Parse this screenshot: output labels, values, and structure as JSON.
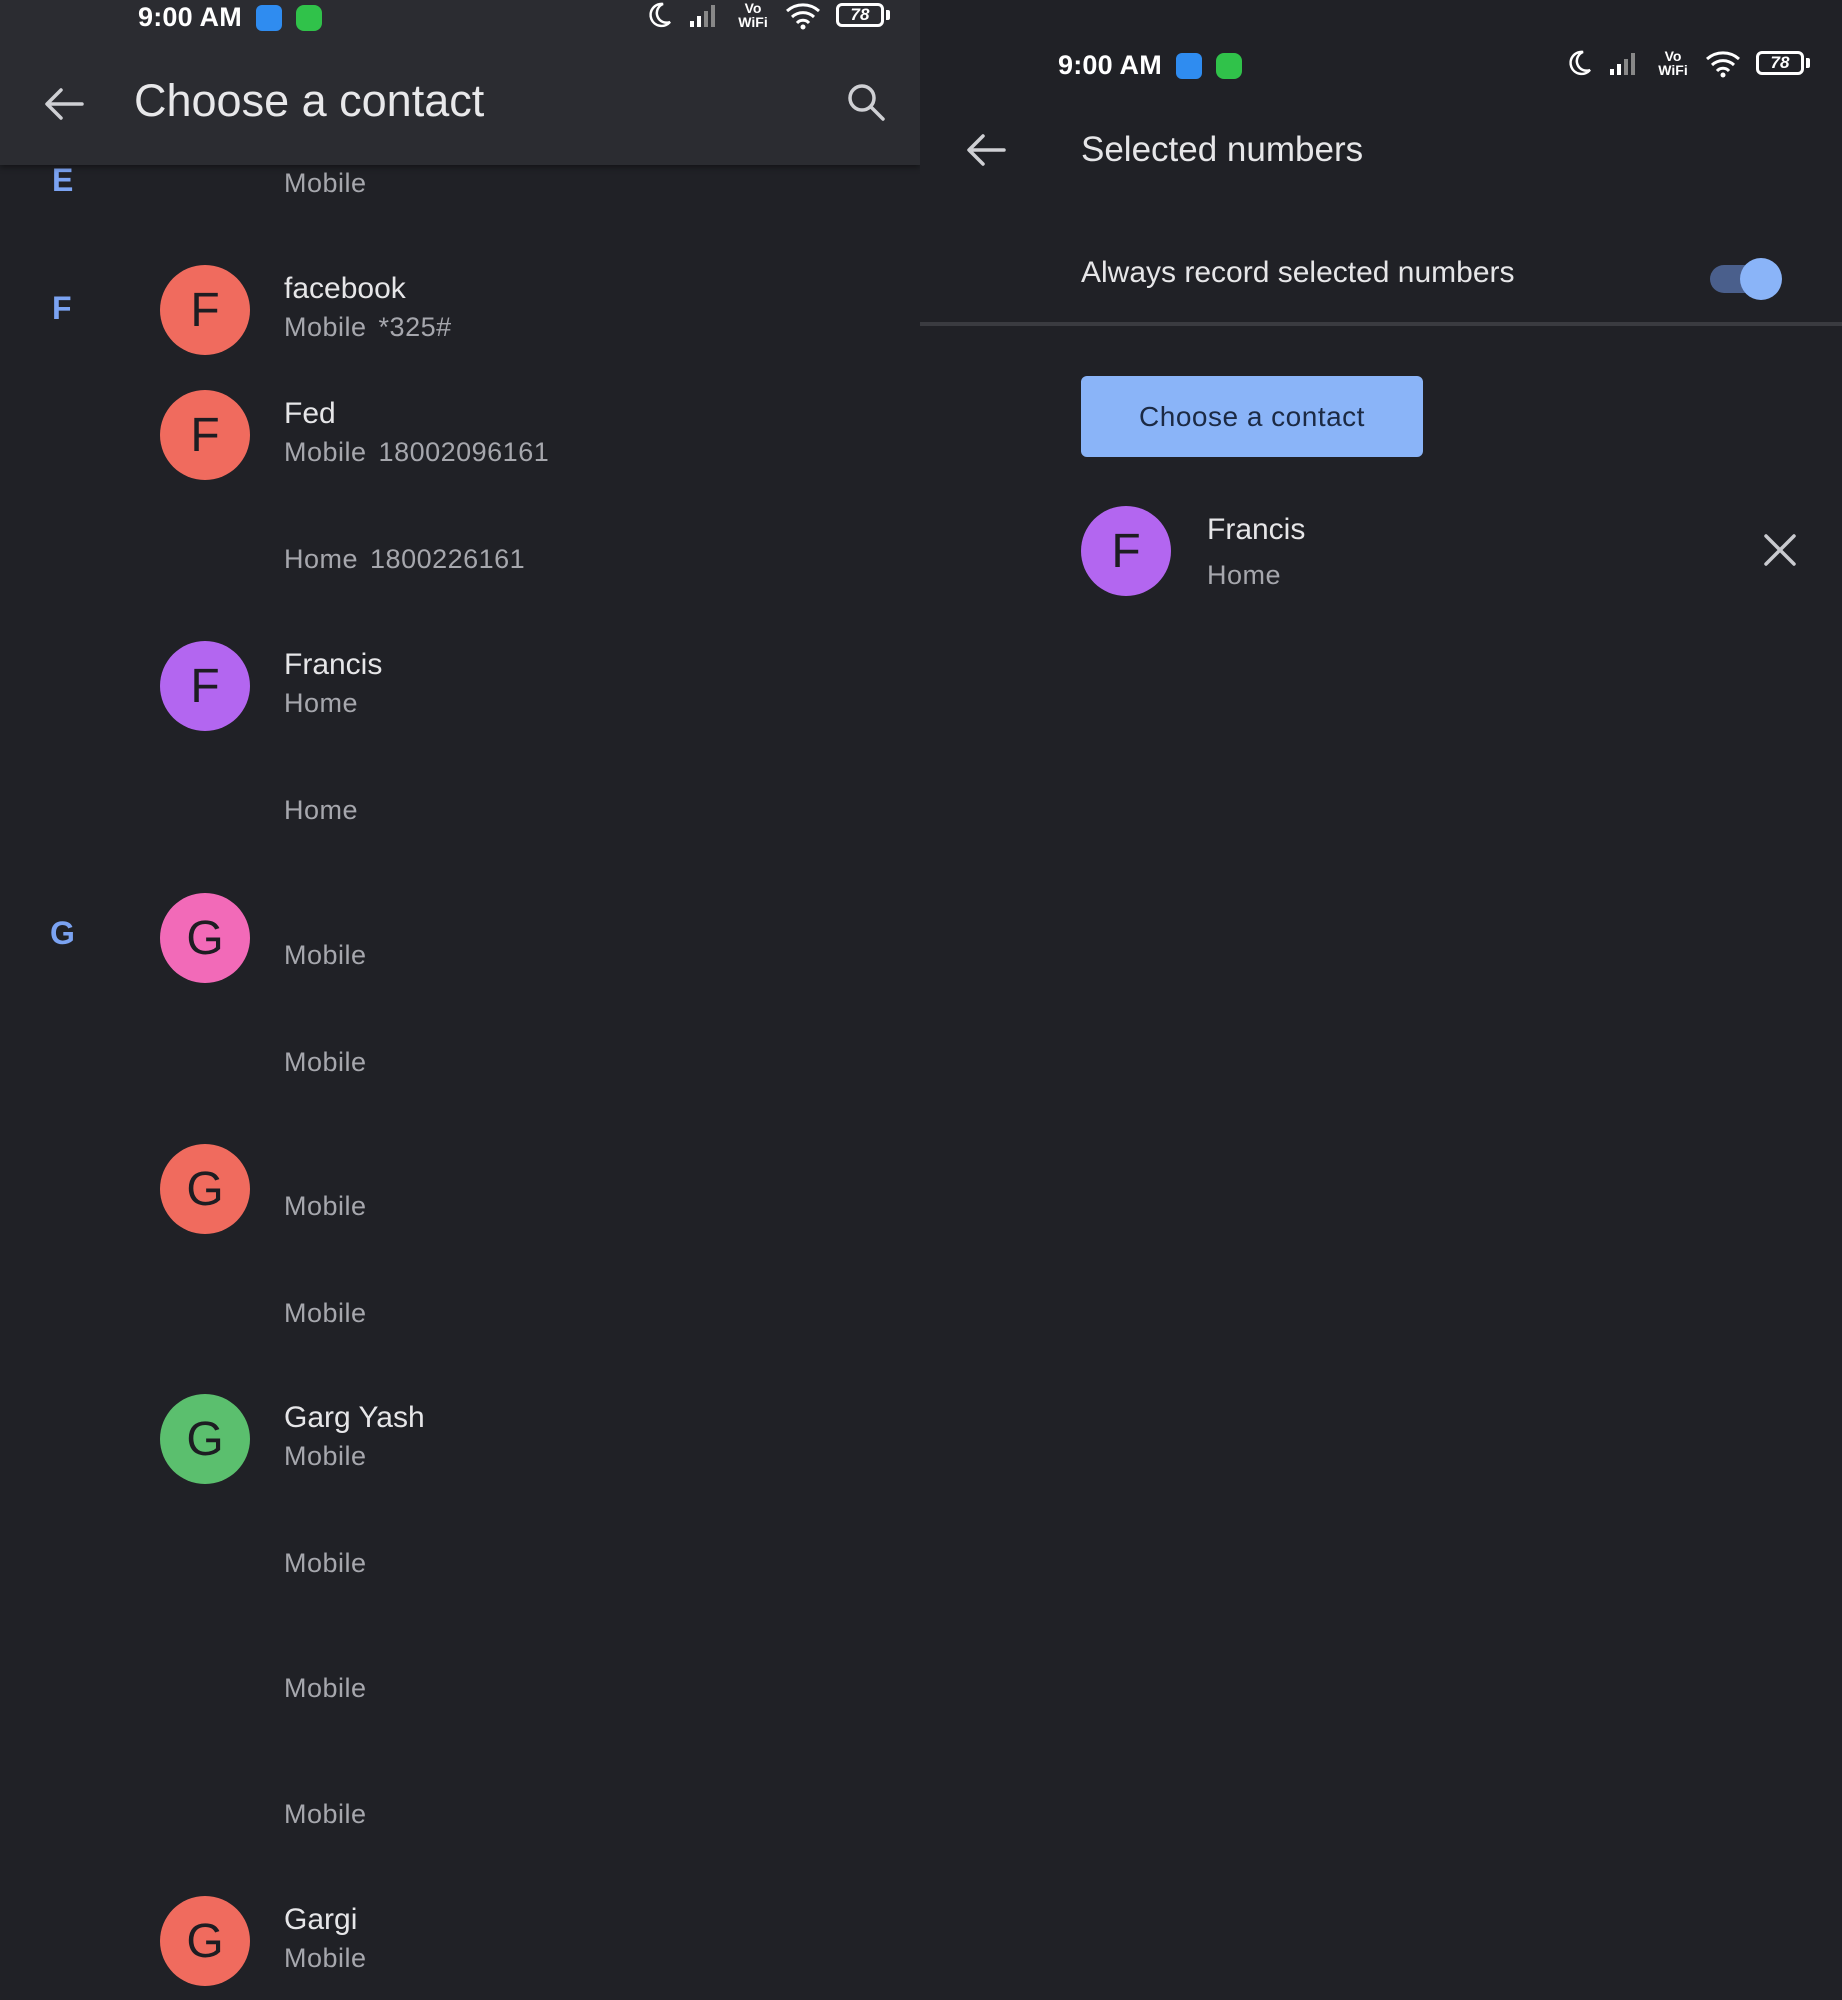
{
  "left_screen": {
    "status_bar": {
      "time": "9:00 AM",
      "vowifi": "Vo WiFi",
      "battery": "78"
    },
    "header": {
      "title": "Choose a contact"
    },
    "contacts": [
      {
        "section": "E",
        "sub_label": "Mobile",
        "sub_number": ""
      },
      {
        "section": "F",
        "initial": "F",
        "name": "facebook",
        "sub_label": "Mobile",
        "sub_number": "*325#",
        "color": "#f06b5e"
      },
      {
        "initial": "F",
        "name": "Fed",
        "sub_label": "Mobile",
        "sub_number": "18002096161",
        "color": "#f06b5e"
      },
      {
        "sub_label": "Home",
        "sub_number": "1800226161"
      },
      {
        "initial": "F",
        "name": "Francis",
        "sub_label": "Home",
        "sub_number": "",
        "color": "#b366f0"
      },
      {
        "sub_label": "Home",
        "sub_number": ""
      },
      {
        "section": "G",
        "initial": "G",
        "name": "",
        "sub_label": "Mobile",
        "sub_number": "",
        "color": "#f26ab8"
      },
      {
        "sub_label": "Mobile",
        "sub_number": ""
      },
      {
        "initial": "G",
        "name": "",
        "sub_label": "Mobile",
        "sub_number": "",
        "color": "#f06b5e"
      },
      {
        "sub_label": "Mobile",
        "sub_number": ""
      },
      {
        "initial": "G",
        "name": "Garg Yash",
        "sub_label": "Mobile",
        "sub_number": "",
        "color": "#5bbf6e"
      },
      {
        "sub_label": "Mobile",
        "sub_number": ""
      },
      {
        "sub_label": "Mobile",
        "sub_number": ""
      },
      {
        "sub_label": "Mobile",
        "sub_number": ""
      },
      {
        "initial": "G",
        "name": "Gargi",
        "sub_label": "Mobile",
        "sub_number": "",
        "color": "#f06b5e"
      }
    ]
  },
  "right_screen": {
    "status_bar": {
      "time": "9:00 AM",
      "vowifi": "Vo WiFi",
      "battery": "78"
    },
    "header": {
      "title": "Selected numbers"
    },
    "toggle": {
      "label": "Always record selected numbers",
      "on": true
    },
    "choose_button": {
      "label": "Choose a contact"
    },
    "selected": [
      {
        "initial": "F",
        "name": "Francis",
        "sub_label": "Home",
        "color": "#b366f0"
      }
    ]
  },
  "colors": {
    "background": "#202126",
    "appbar": "#2b2c31",
    "accent": "#8ab4f8",
    "section_letter": "#7ba3f2"
  }
}
